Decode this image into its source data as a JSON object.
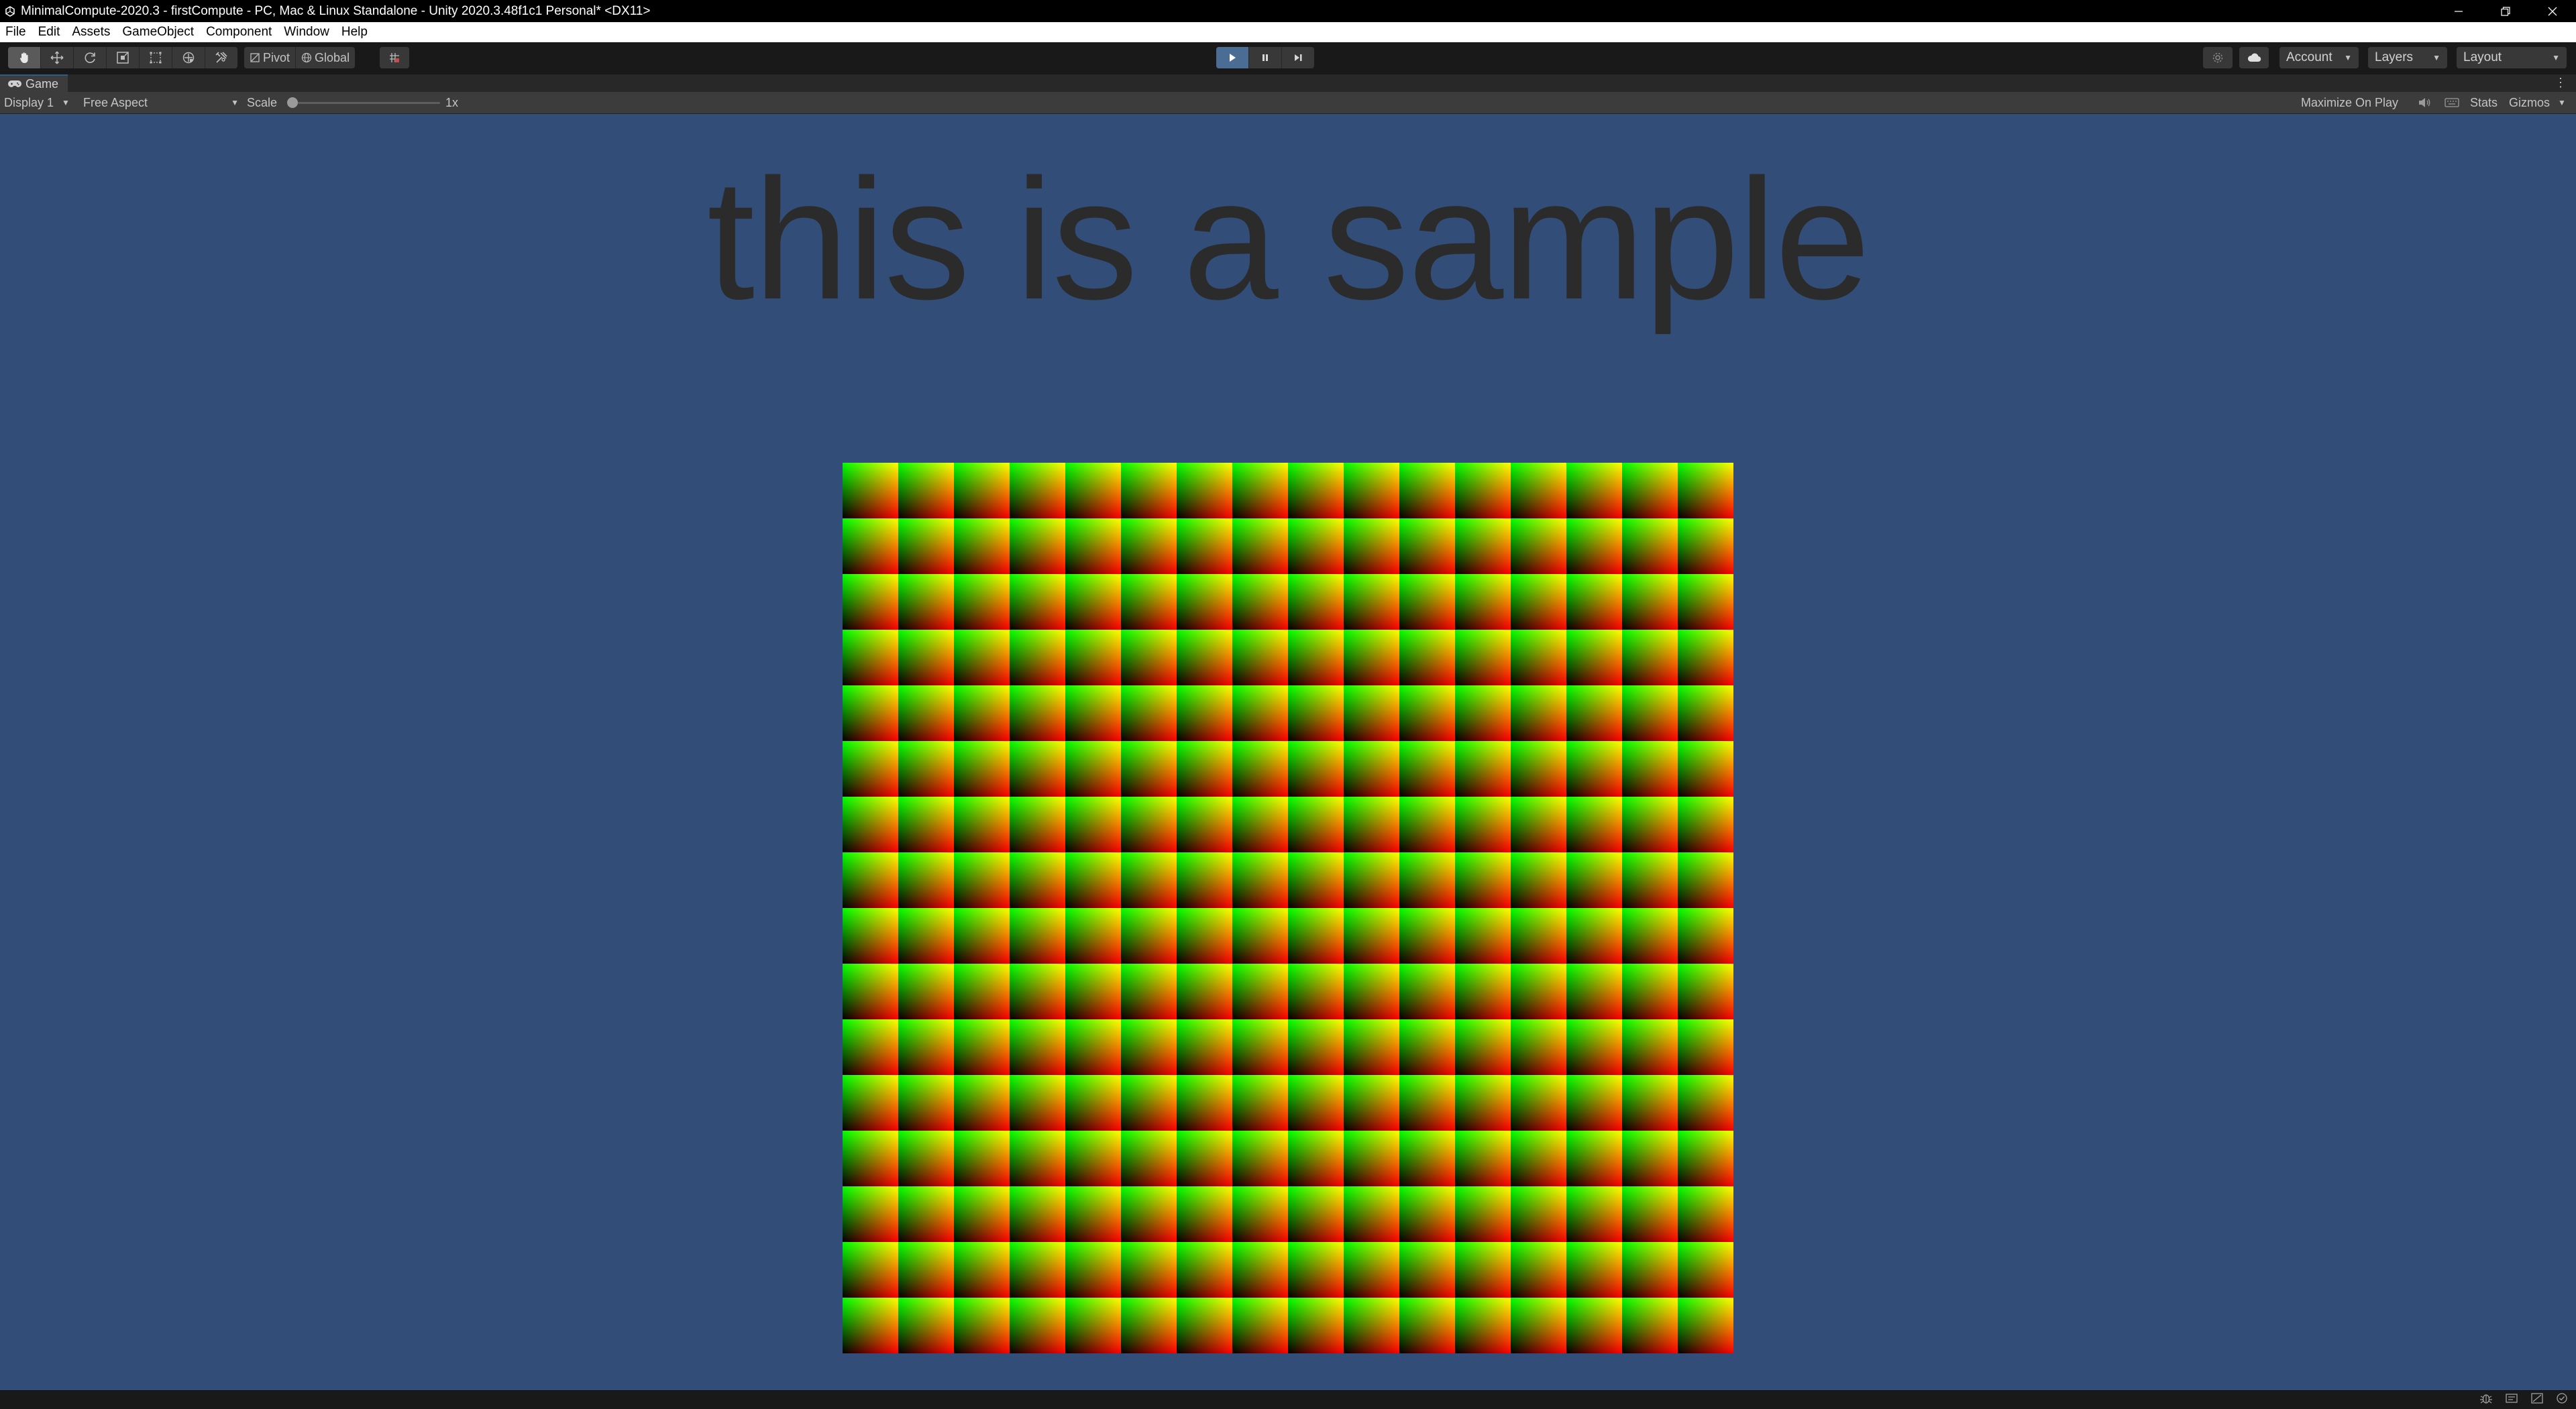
{
  "window": {
    "title": "MinimalCompute-2020.3 - firstCompute - PC, Mac & Linux Standalone - Unity 2020.3.48f1c1 Personal* <DX11>"
  },
  "menu": [
    "File",
    "Edit",
    "Assets",
    "GameObject",
    "Component",
    "Window",
    "Help"
  ],
  "toolbar": {
    "tools": [
      "hand-tool-icon",
      "move-tool-icon",
      "rotate-tool-icon",
      "scale-tool-icon",
      "rect-tool-icon",
      "transform-tool-icon",
      "custom-tool-icon"
    ],
    "pivot_label": "Pivot",
    "global_label": "Global",
    "play_active": true,
    "account_label": "Account",
    "layers_label": "Layers",
    "layout_label": "Layout"
  },
  "game_tab": {
    "label": "Game"
  },
  "game_controls": {
    "display_label": "Display 1",
    "aspect_label": "Free Aspect",
    "scale_label": "Scale",
    "scale_value": "1x",
    "maximize_label": "Maximize On Play",
    "stats_label": "Stats",
    "gizmos_label": "Gizmos"
  },
  "viewport": {
    "background_color": "#324e78",
    "sample_text": "this is a sample",
    "texture": {
      "tiles_per_side": 16,
      "colors": [
        "red",
        "green",
        "yellow",
        "black"
      ]
    }
  },
  "colors": {
    "play_active": "#4b6d93",
    "tab_accent": "#2c5d87"
  }
}
